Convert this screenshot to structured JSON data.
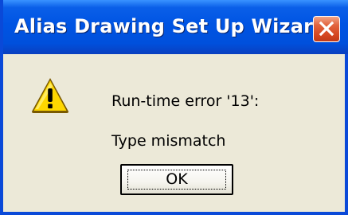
{
  "window": {
    "title": "Alias Drawing Set Up Wizard",
    "title_color": "#ffffff",
    "titlebar_color": "#0054e3",
    "close_icon": "close-icon"
  },
  "dialog": {
    "icon": "warning-icon",
    "icon_color": "#ffd700",
    "message_line1": "Run-time error '13':",
    "message_line2": "Type mismatch",
    "ok_label": "OK"
  }
}
